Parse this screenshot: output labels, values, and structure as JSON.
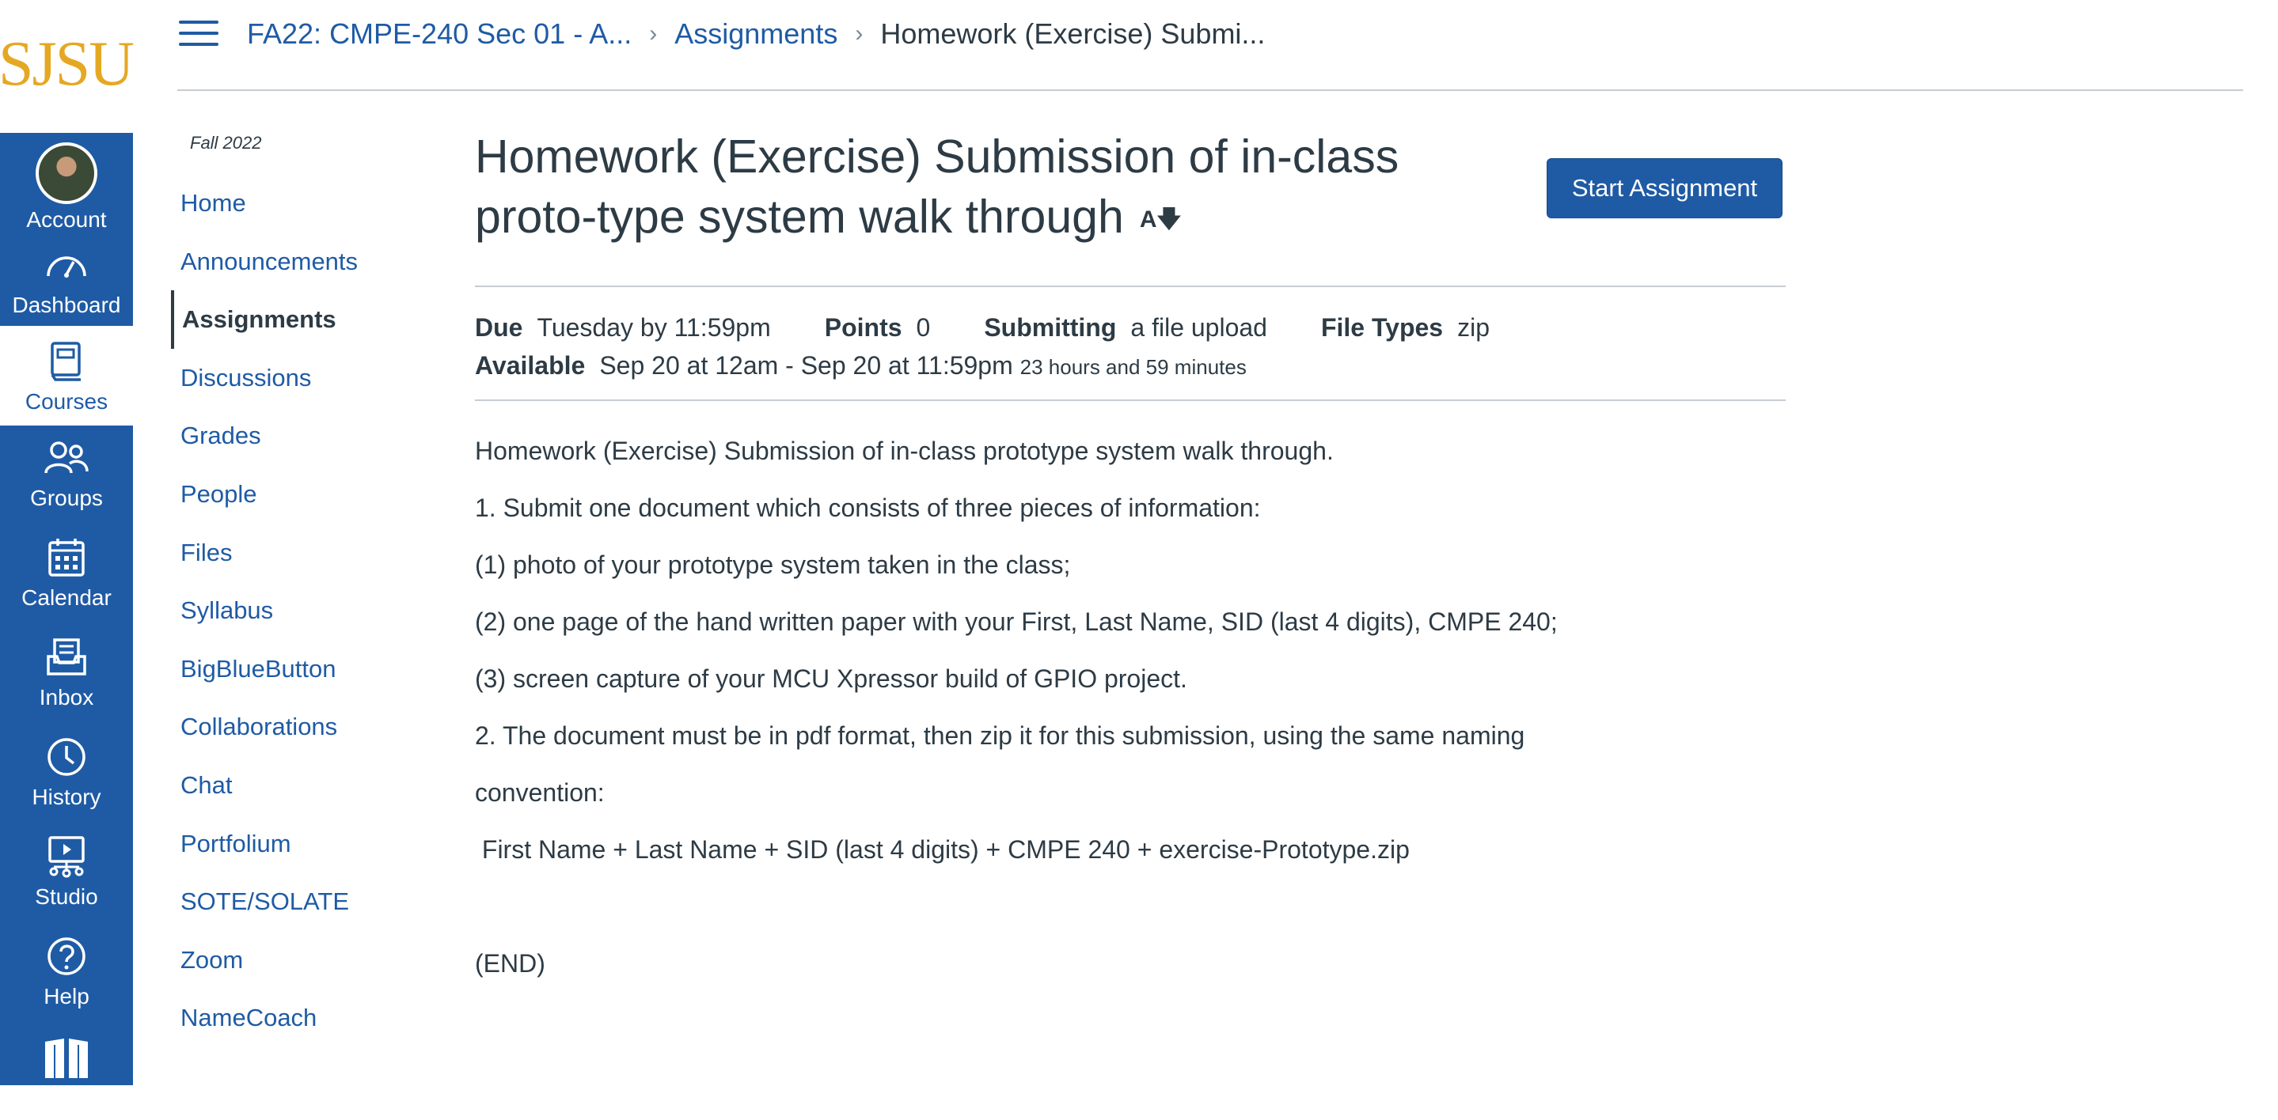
{
  "logo": {
    "text": "SJSU"
  },
  "global_nav": [
    {
      "label": "Account",
      "icon": "avatar"
    },
    {
      "label": "Dashboard",
      "icon": "dashboard-icon"
    },
    {
      "label": "Courses",
      "icon": "courses-icon"
    },
    {
      "label": "Groups",
      "icon": "groups-icon"
    },
    {
      "label": "Calendar",
      "icon": "calendar-icon"
    },
    {
      "label": "Inbox",
      "icon": "inbox-icon"
    },
    {
      "label": "History",
      "icon": "history-icon"
    },
    {
      "label": "Studio",
      "icon": "studio-icon"
    },
    {
      "label": "Help",
      "icon": "help-icon"
    }
  ],
  "breadcrumb": {
    "course": "FA22: CMPE-240 Sec 01 - A...",
    "section": "Assignments",
    "current": "Homework (Exercise) Submi..."
  },
  "course_nav": {
    "term": "Fall 2022",
    "items": [
      "Home",
      "Announcements",
      "Assignments",
      "Discussions",
      "Grades",
      "People",
      "Files",
      "Syllabus",
      "BigBlueButton",
      "Collaborations",
      "Chat",
      "Portfolium",
      "SOTE/SOLATE",
      "Zoom",
      "NameCoach"
    ]
  },
  "assignment": {
    "title": "Homework (Exercise) Submission of in-class proto-type system walk through",
    "start_button": "Start Assignment",
    "due_label": "Due",
    "due_value": "Tuesday by 11:59pm",
    "points_label": "Points",
    "points_value": "0",
    "submitting_label": "Submitting",
    "submitting_value": "a file upload",
    "file_types_label": "File Types",
    "file_types_value": "zip",
    "available_label": "Available",
    "available_value": "Sep 20 at 12am - Sep 20 at 11:59pm",
    "available_duration": "23 hours and 59 minutes"
  },
  "description": [
    "Homework (Exercise) Submission of in-class prototype system walk through.",
    "1. Submit one document which consists of three pieces of information:",
    "(1) photo of your prototype system taken in the class;",
    "(2) one page of the hand written paper with your First, Last Name, SID (last 4 digits), CMPE 240;",
    "(3) screen capture of your MCU Xpressor build of GPIO project.",
    "2. The document must be in pdf format, then zip it for this submission, using the same naming",
    "convention:",
    " First Name + Last Name + SID (last 4 digits) + CMPE 240 + exercise-Prototype.zip",
    "",
    "(END)"
  ],
  "colors": {
    "brand": "#1f5ba5",
    "logo": "#e5a823",
    "text": "#2d3b45"
  }
}
